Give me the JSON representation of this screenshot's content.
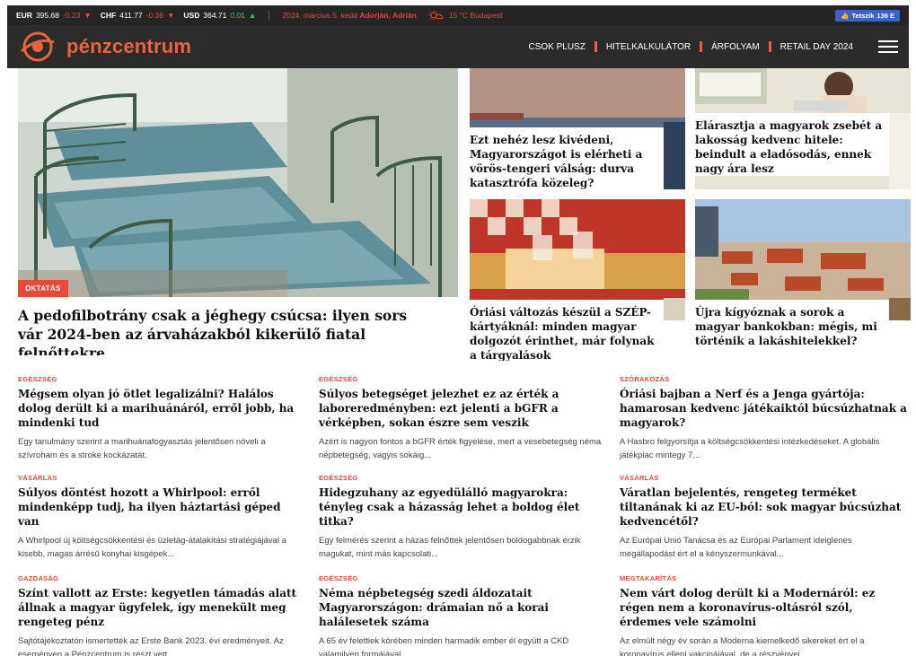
{
  "ticker": {
    "eur": {
      "label": "EUR",
      "value": "395.68",
      "change": "-0.23"
    },
    "chf": {
      "label": "CHF",
      "value": "411.77",
      "change": "-0.39"
    },
    "usd": {
      "label": "USD",
      "value": "364.71",
      "change": "0.01"
    },
    "date_text": "2024. március 5. kedd",
    "names": "Adorján, Adrián",
    "weather": "15 °C Budapest",
    "fb_label": "Tetszik",
    "fb_count": "136 E"
  },
  "header": {
    "logo_text": "pénzcentrum",
    "nav": [
      "CSOK PLUSZ",
      "HITELKALKULÁTOR",
      "ÁRFOLYAM",
      "RETAIL DAY 2024"
    ]
  },
  "hero": {
    "badge": "OKTATÁS",
    "title": "A pedofilbotrány csak a jéghegy csúcsa: ilyen sors vár 2024-ben az árvaházakból kikerülő fiatal felnőttekre"
  },
  "cards": [
    {
      "title": "Ezt nehéz lesz kivédeni, Magyarországot is elérheti a vörös-tengeri válság: durva katasztrófa közeleg?"
    },
    {
      "title": "Elárasztja a magyarok zsebét a lakosság kedvenc hitele: beindult a eladósodás, ennek nagy ára lesz"
    },
    {
      "title": "Óriási változás készül a SZÉP-kártyáknál: minden magyar dolgozót érinthet, már folynak a tárgyalások"
    },
    {
      "title": "Újra kígyóznak a sorok a magyar bankokban: mégis, mi történik a lakáshitelekkel?"
    }
  ],
  "articles": [
    {
      "cat": "EGÉSZSÉG",
      "title": "Mégsem olyan jó ötlet legalizálni? Halálos dolog derült ki a marihuánáról, erről jobb, ha mindenki tud",
      "desc": "Egy tanulmány szerint a marihuánafogyasztás jelentősen növeli a szívroham és a stroke kockázatát."
    },
    {
      "cat": "EGÉSZSÉG",
      "title": "Súlyos betegséget jelezhet ez az érték a laboreredményben: ezt jelenti a bGFR a vérképben, sokan észre sem veszik",
      "desc": "Azért is nagyon fontos a bGFR érték figyelése, mert a vesebetegség néma népbetegség, vagyis sokáig..."
    },
    {
      "cat": "SZÓRAKOZÁS",
      "title": "Óriási bajban a Nerf és a Jenga gyártója: hamarosan kedvenc játékaiktól búcsúzhatnak a magyarok?",
      "desc": "A Hasbro felgyorsítja a költségcsökkentési intézkedéseket. A globális játékpiac mintegy 7..."
    },
    {
      "cat": "VÁSÁRLÁS",
      "title": "Súlyos döntést hozott a Whirlpool: erről mindenképp tudj, ha ilyen háztartási géped van",
      "desc": "A Whirlpool új költségcsökkentési és üzletág-átalakítási stratégiájával a kisebb, magas árrésű konyhai kisgépek..."
    },
    {
      "cat": "EGÉSZSÉG",
      "title": "Hidegzuhany az egyedülálló magyarokra: tényleg csak a házasság lehet a boldog élet titka?",
      "desc": "Egy felmérés szerint a házas felnőttek jelentősen boldogabbnak érzik magukat, mint más kapcsolati..."
    },
    {
      "cat": "VÁSÁRLÁS",
      "title": "Váratlan bejelentés, rengeteg terméket tiltanának ki az EU-ból: sok magyar búcsúzhat kedvencétől?",
      "desc": "Az Európai Unió Tanácsa és az Európai Parlament ideiglenes megállapodást ért el a kényszermunkával..."
    },
    {
      "cat": "GAZDASÁG",
      "title": "Színt vallott az Erste: kegyetlen támadás alatt állnak a magyar ügyfelek, így menekült meg rengeteg pénz",
      "desc": "Sajtótájékoztatón ismertették az Erste Bank 2023. évi eredményeit. Az eseményen a Pénzcentrum is részt vett."
    },
    {
      "cat": "EGÉSZSÉG",
      "title": "Néma népbetegség szedi áldozatait Magyarországon: drámaian nő a korai halálesetek száma",
      "desc": "A 65 év felettiek körében minden harmadik ember él együtt a CKD valamilyen formájával."
    },
    {
      "cat": "MEGTAKARÍTÁS",
      "title": "Nem várt dolog derült ki a Modernáról: ez régen nem a koronavírus-oltásról szól, érdemes vele számolni",
      "desc": "Az elmúlt négy év során a Moderna kiemelkedő sikereket ért el a koronavírus elleni vakcinájával, de a részvényei..."
    }
  ],
  "colors": {
    "accent": "#e8643c",
    "badge": "#e8493a",
    "header_bg": "#2b2b2b"
  }
}
